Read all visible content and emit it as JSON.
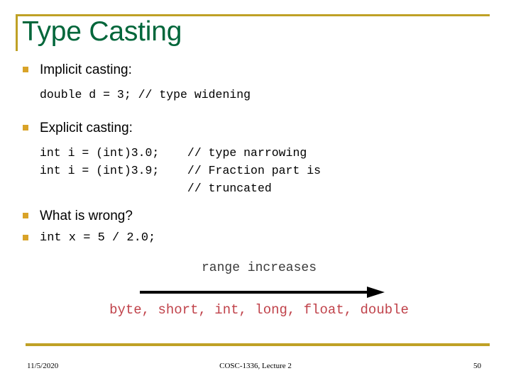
{
  "slide": {
    "title": "Type Casting",
    "title_color": "#00663a",
    "accent_color": "#bfa126",
    "bullet_color": "#d9a328",
    "code_color": "#000000",
    "types_color": "#c0424a"
  },
  "bullets": [
    {
      "label": "Implicit casting:",
      "style": "text"
    },
    {
      "label": "Explicit casting:",
      "style": "text"
    },
    {
      "label": "What is wrong?",
      "style": "text"
    },
    {
      "label": "int x = 5 / 2.0;",
      "style": "mono"
    }
  ],
  "code_blocks": {
    "implicit": "double d = 3; // type widening",
    "explicit_line1": "int i = (int)3.0;    // type narrowing",
    "explicit_line2": "int i = (int)3.9;    // Fraction part is",
    "explicit_line3": "                     // truncated"
  },
  "range_diagram": {
    "caption": "range increases",
    "arrow_icon": "right-arrow-icon",
    "types": "byte, short, int, long, float, double"
  },
  "footer": {
    "date": "11/5/2020",
    "center": "COSC-1336, Lecture 2",
    "slide_number": "50"
  }
}
